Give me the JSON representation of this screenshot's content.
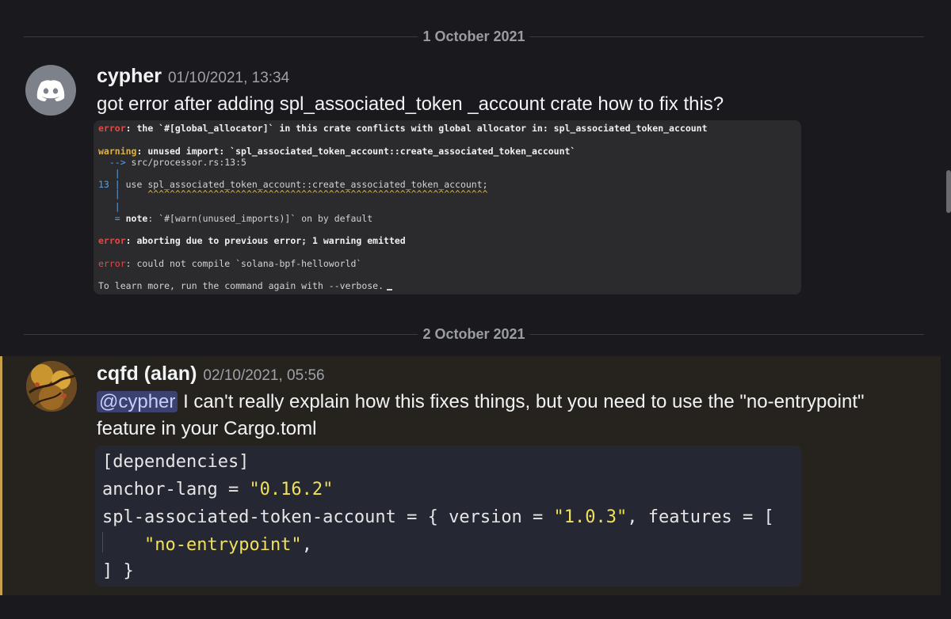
{
  "dividers": [
    {
      "date": "1 October 2021"
    },
    {
      "date": "2 October 2021"
    }
  ],
  "messages": [
    {
      "author": "cypher",
      "timestamp": "01/10/2021, 13:34",
      "text": "got error after adding spl_associated_token _account crate how to fix this?",
      "avatar_icon": "discord-logo-icon"
    },
    {
      "author": "cqfd (alan)",
      "timestamp": "02/10/2021, 05:56",
      "mention": "@cypher",
      "text": " I can't really explain how this fixes things, but you need to use the \"no-entrypoint\"",
      "text2": "feature in your Cargo.toml",
      "avatar_icon": "artwork-avatar-icon"
    }
  ],
  "terminal": {
    "l1_label": "error",
    "l1_text": ": the `#[global_allocator]` in this crate conflicts with global allocator in: spl_associated_token_account",
    "l2_label": "warning",
    "l2_text": ": unused import: `spl_associated_token_account::create_associated_token_account`",
    "l3_arrow": "  --> ",
    "l3_text": "src/processor.rs:13:5",
    "l4": "   |",
    "l5_num": "13 | ",
    "l5_text": "use spl_associated_token_account::create_associated_token_account;",
    "l6_bar": "   | ",
    "l6_carets": "    ^^^^^^^^^^^^^^^^^^^^^^^^^^^^^^^^^^^^^^^^^^^^^^^^^^^^^^^^^^^^^^",
    "l7": "   |",
    "l8_eq": "   = ",
    "l8_note": "note",
    "l8_text": ": `#[warn(unused_imports)]` on by default",
    "l9_label": "error",
    "l9_text": ": aborting due to previous error; 1 warning emitted",
    "l10_label": "error",
    "l10_text": ": could not compile `solana-bpf-helloworld`",
    "l11": "To learn more, run the command again with --verbose."
  },
  "code": {
    "l1": "[dependencies]",
    "l2_key": "anchor-lang = ",
    "l2_val": "\"0.16.2\"",
    "l3_key": "spl-associated-token-account = { version = ",
    "l3_val": "\"1.0.3\"",
    "l3_rest": ", features = [",
    "l4_val": "\"no-entrypoint\"",
    "l4_rest": ",",
    "l5": "] }"
  },
  "colors": {
    "background": "#1a1a1e",
    "highlight_bar": "#c7a04a",
    "mention_bg": "#3c4270",
    "code_string": "#f1e05a"
  }
}
